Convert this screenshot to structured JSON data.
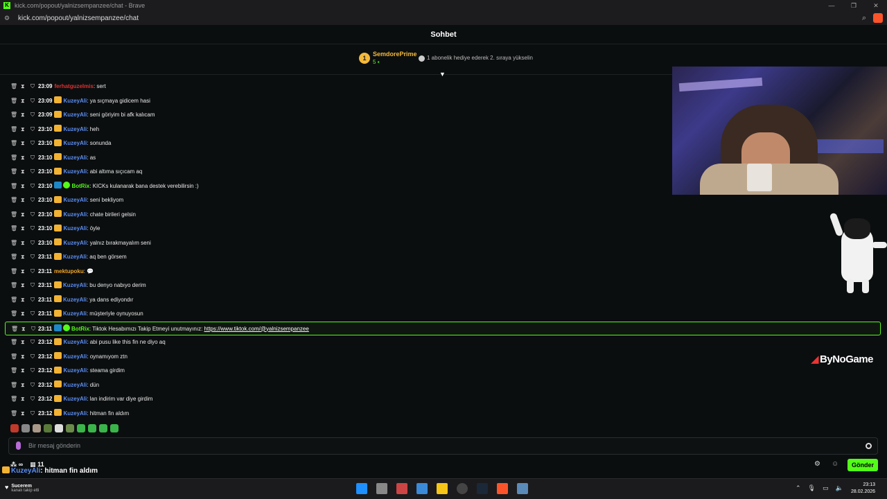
{
  "window": {
    "title": "kick.com/popout/yalnizsempanzee/chat - Brave",
    "url": "kick.com/popout/yalnizsempanzee/chat"
  },
  "chat": {
    "header": "Sohbet",
    "leaderboard": {
      "rank": "1",
      "name": "SemdorePrime",
      "count": "5",
      "hint": "1 abonelik hediye ederek 2. sıraya yükselin"
    },
    "messages": [
      {
        "time": "23:09",
        "user": "ferhatguzelmis",
        "color": "#e03030",
        "badges": [],
        "text": "sert"
      },
      {
        "time": "23:09",
        "user": "KuzeyAli",
        "color": "#5b8ef5",
        "badges": [
          "crown"
        ],
        "text": "ya sıçmaya gidicem hasi"
      },
      {
        "time": "23:09",
        "user": "KuzeyAli",
        "color": "#5b8ef5",
        "badges": [
          "crown"
        ],
        "text": "seni göriyim bi afk kalıcam"
      },
      {
        "time": "23:10",
        "user": "KuzeyAli",
        "color": "#5b8ef5",
        "badges": [
          "crown"
        ],
        "text": "heh"
      },
      {
        "time": "23:10",
        "user": "KuzeyAli",
        "color": "#5b8ef5",
        "badges": [
          "crown"
        ],
        "text": "sonunda"
      },
      {
        "time": "23:10",
        "user": "KuzeyAli",
        "color": "#5b8ef5",
        "badges": [
          "crown"
        ],
        "text": "as"
      },
      {
        "time": "23:10",
        "user": "KuzeyAli",
        "color": "#5b8ef5",
        "badges": [
          "crown"
        ],
        "text": "abi altıma sıçıcam aq"
      },
      {
        "time": "23:10",
        "user": "BotRix",
        "color": "#53fc18",
        "badges": [
          "bot",
          "verified"
        ],
        "text": "KICKs kulanarak bana destek verebilirsin :)"
      },
      {
        "time": "23:10",
        "user": "KuzeyAli",
        "color": "#5b8ef5",
        "badges": [
          "crown"
        ],
        "text": "seni bekliyom"
      },
      {
        "time": "23:10",
        "user": "KuzeyAli",
        "color": "#5b8ef5",
        "badges": [
          "crown"
        ],
        "text": "chate birileri gelsin"
      },
      {
        "time": "23:10",
        "user": "KuzeyAli",
        "color": "#5b8ef5",
        "badges": [
          "crown"
        ],
        "text": "öyle"
      },
      {
        "time": "23:10",
        "user": "KuzeyAli",
        "color": "#5b8ef5",
        "badges": [
          "crown"
        ],
        "text": "yalnız bırakmayalım seni"
      },
      {
        "time": "23:11",
        "user": "KuzeyAli",
        "color": "#5b8ef5",
        "badges": [
          "crown"
        ],
        "text": "aq ben görsem"
      },
      {
        "time": "23:11",
        "user": "mektupoku",
        "color": "#f5a623",
        "badges": [],
        "text": "💬"
      },
      {
        "time": "23:11",
        "user": "KuzeyAli",
        "color": "#5b8ef5",
        "badges": [
          "crown"
        ],
        "text": "bu denyo nabıyo derim"
      },
      {
        "time": "23:11",
        "user": "KuzeyAli",
        "color": "#5b8ef5",
        "badges": [
          "crown"
        ],
        "text": "ya dans ediyondır"
      },
      {
        "time": "23:11",
        "user": "KuzeyAli",
        "color": "#5b8ef5",
        "badges": [
          "crown"
        ],
        "text": "müşteriyle oynuyosun"
      },
      {
        "time": "23:11",
        "user": "BotRix",
        "color": "#53fc18",
        "badges": [
          "bot",
          "verified"
        ],
        "text": "Tiktok Hesabımızı Takip Etmeyi unutmayınız: ",
        "link": "https://www.tiktok.com/@yalnizsempanzee",
        "highlight": true
      },
      {
        "time": "23:12",
        "user": "KuzeyAli",
        "color": "#5b8ef5",
        "badges": [
          "crown"
        ],
        "text": "abi pusu like this fin ne diyo aq"
      },
      {
        "time": "23:12",
        "user": "KuzeyAli",
        "color": "#5b8ef5",
        "badges": [
          "crown"
        ],
        "text": "oynamıyom ztn"
      },
      {
        "time": "23:12",
        "user": "KuzeyAli",
        "color": "#5b8ef5",
        "badges": [
          "crown"
        ],
        "text": "steama girdim"
      },
      {
        "time": "23:12",
        "user": "KuzeyAli",
        "color": "#5b8ef5",
        "badges": [
          "crown"
        ],
        "text": "dün"
      },
      {
        "time": "23:12",
        "user": "KuzeyAli",
        "color": "#5b8ef5",
        "badges": [
          "crown"
        ],
        "text": "lan indirim var diye girdim"
      },
      {
        "time": "23:12",
        "user": "KuzeyAli",
        "color": "#5b8ef5",
        "badges": [
          "crown"
        ],
        "text": "hitman fin aldım"
      }
    ],
    "input_placeholder": "Bir mesaj gönderin",
    "send_label": "Gönder",
    "viewer_infinity": "∞",
    "calendar_count": "11"
  },
  "overlay": {
    "watermark": "ByNoGame",
    "last_message_user": "KuzeyAli",
    "last_message_text": ": hitman fin aldım"
  },
  "taskbar": {
    "weather_label": "Sucerem",
    "weather_sub": "kanalı takip etti",
    "time": "23:13",
    "date": "28.02.2026"
  },
  "colors": {
    "accent": "#53fc18",
    "crown": "#f2b233",
    "user_blue": "#5b8ef5"
  }
}
